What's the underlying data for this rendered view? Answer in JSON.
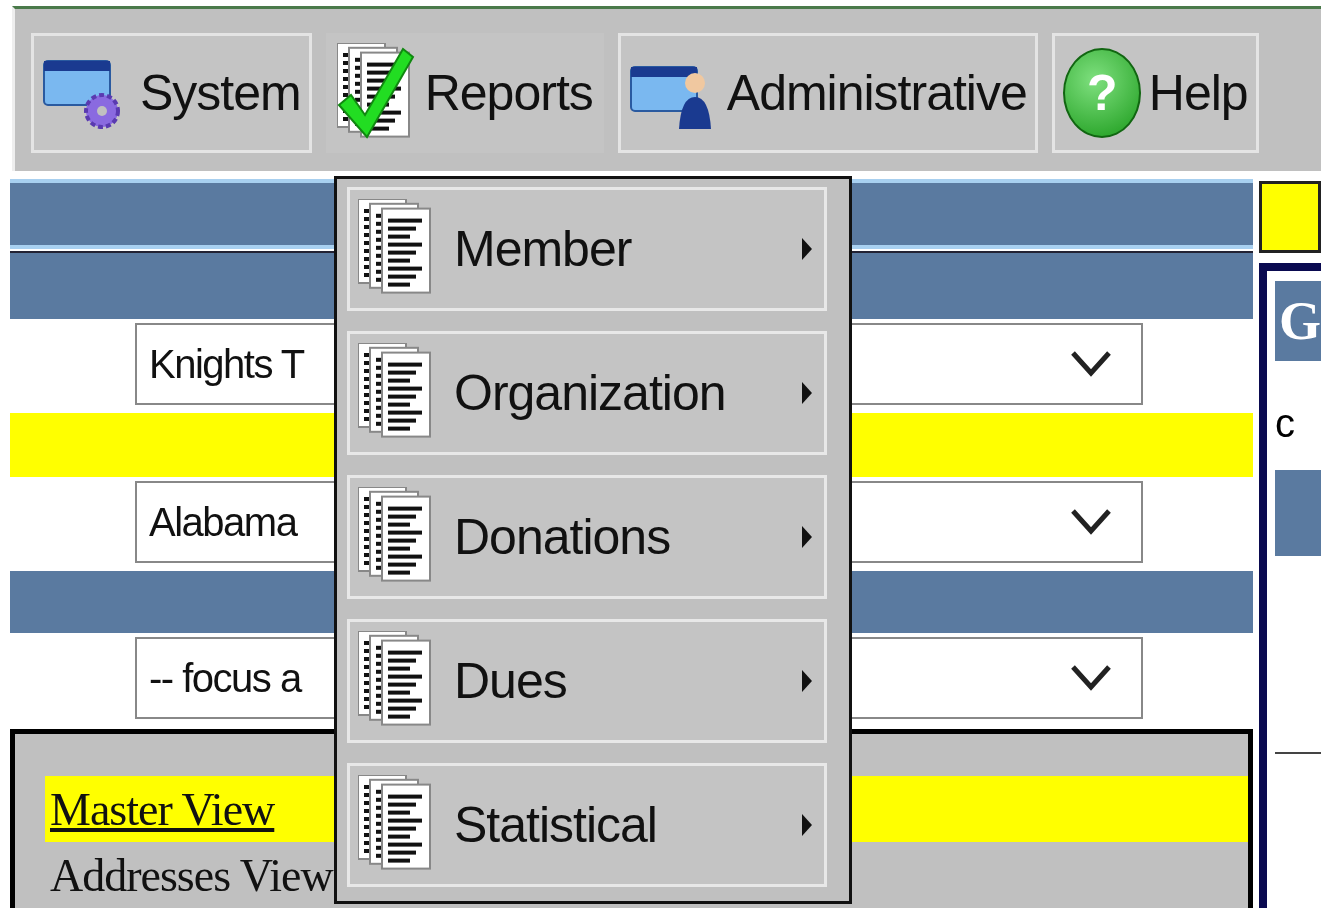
{
  "menubar": {
    "items": [
      {
        "label": "System",
        "kind": "system",
        "selected": false
      },
      {
        "label": "Reports",
        "kind": "reports",
        "selected": true
      },
      {
        "label": "Administrative",
        "kind": "admin",
        "selected": false
      },
      {
        "label": "Help",
        "kind": "help",
        "glyph": "?",
        "selected": false
      }
    ]
  },
  "dropdown": {
    "items": [
      {
        "label": "Member"
      },
      {
        "label": "Organization"
      },
      {
        "label": "Donations"
      },
      {
        "label": "Dues"
      },
      {
        "label": "Statistical"
      }
    ]
  },
  "filters": [
    {
      "value": "Knights T"
    },
    {
      "value": "Alabama"
    },
    {
      "value": "-- focus a"
    }
  ],
  "views": [
    {
      "label": "Master View",
      "selected": true
    },
    {
      "label": "Addresses View",
      "selected": false
    }
  ],
  "side_panel": {
    "title": "G",
    "text": "c"
  }
}
